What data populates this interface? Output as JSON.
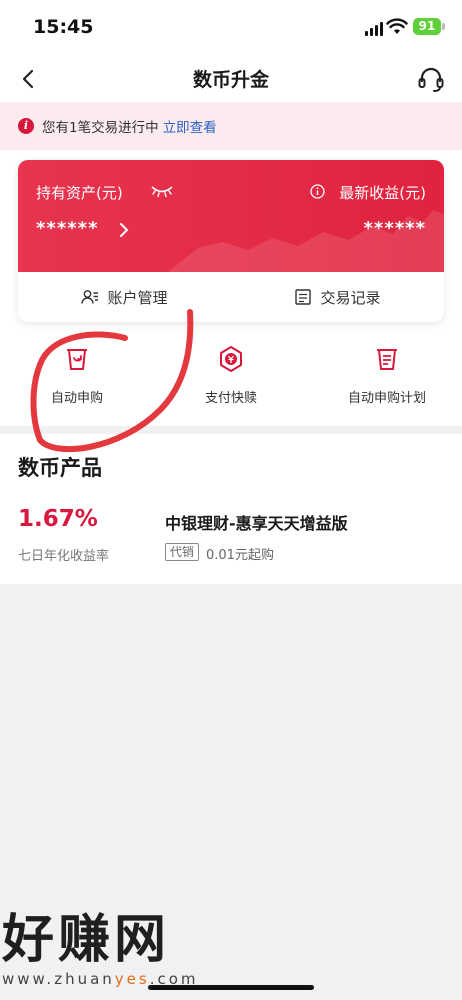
{
  "status_bar": {
    "time": "15:45",
    "battery": "91"
  },
  "nav": {
    "title": "数币升金"
  },
  "notice": {
    "text": "您有1笔交易进行中",
    "link": "立即查看"
  },
  "card": {
    "asset_label": "持有资产(元)",
    "income_label": "最新收益(元)",
    "asset_value": "******",
    "income_value": "******",
    "actions": [
      {
        "label": "账户管理",
        "icon": "account-manage-icon"
      },
      {
        "label": "交易记录",
        "icon": "records-icon"
      }
    ]
  },
  "quick_actions": [
    {
      "label": "自动申购",
      "icon": "auto-subscribe-icon"
    },
    {
      "label": "支付快赎",
      "icon": "quick-redeem-icon"
    },
    {
      "label": "自动申购计划",
      "icon": "auto-plan-icon"
    }
  ],
  "products": {
    "section_title": "数币产品",
    "items": [
      {
        "rate": "1.67%",
        "rate_label": "七日年化收益率",
        "name": "中银理财-惠享天天增益版",
        "tag": "代销",
        "min_buy": "0.01元起购"
      }
    ]
  },
  "watermark": {
    "main": "好赚网",
    "url_prefix": "www.zhuan",
    "url_highlight": "yes",
    "url_suffix": ".com"
  },
  "colors": {
    "accent": "#e0233f",
    "link": "#2b62c6",
    "rate": "#d8173d",
    "annotation": "#e3383d"
  }
}
